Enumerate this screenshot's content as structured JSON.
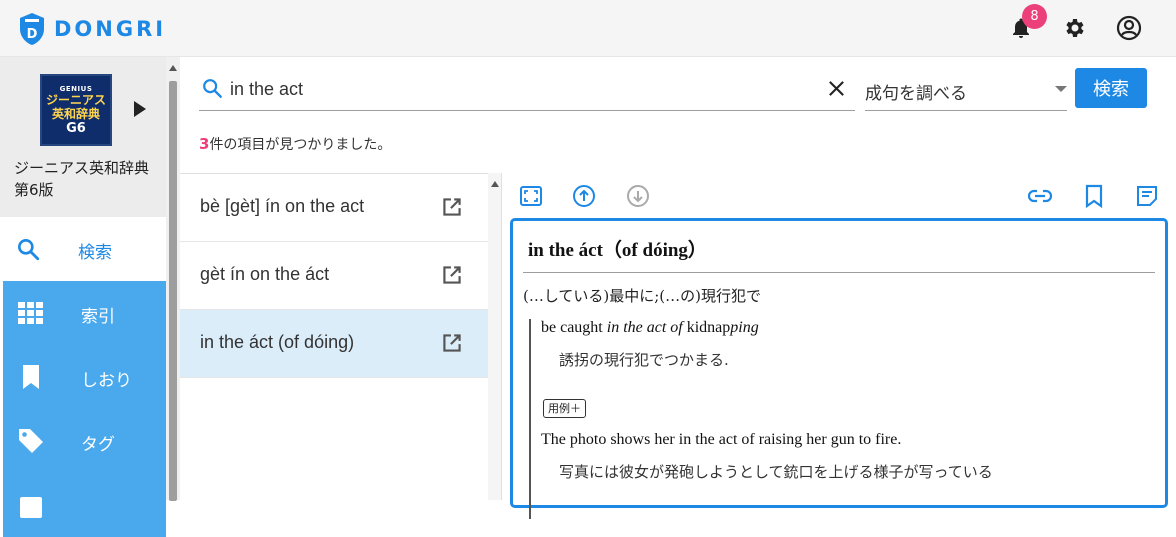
{
  "app": {
    "logo_text": "DONGRI",
    "notification_count": "8"
  },
  "dictionary": {
    "cover": {
      "genius": "GENIUS",
      "title": "ジーニアス英和辞典",
      "edition": "G6"
    },
    "name": "ジーニアス英和辞典第6版"
  },
  "nav": {
    "items": [
      {
        "label": "検索",
        "icon": "search-icon"
      },
      {
        "label": "索引",
        "icon": "grid-icon"
      },
      {
        "label": "しおり",
        "icon": "bookmark-icon"
      },
      {
        "label": "タグ",
        "icon": "tag-icon"
      }
    ]
  },
  "search": {
    "query": "in the act",
    "mode": "成句を調べる",
    "button_label": "検索",
    "result_count": "3",
    "result_suffix": "件の項目が見つかりました。"
  },
  "results": [
    {
      "label": "bè [gèt] ín on the act"
    },
    {
      "label": "gèt ín on the áct"
    },
    {
      "label": "in the áct (of dóing)",
      "selected": true
    }
  ],
  "entry": {
    "headword": "in the áct（of dóing）",
    "definition": "(…している)最中に;(…の)現行犯で",
    "example1": {
      "en_prefix": "be caught ",
      "en_italic": "in the act of",
      "en_mid": " kidnap",
      "en_italic2": "ping",
      "ja": "誘拐の現行犯でつかまる."
    },
    "example_tag": "用例＋",
    "example2": {
      "en": "The photo shows her in the act of raising her gun to fire.",
      "ja": "写真には彼女が発砲しようとして銃口を上げる様子が写っている"
    }
  },
  "colors": {
    "accent": "#1e88e5",
    "badge": "#ec407a",
    "nav_blue": "#4aa8ec",
    "selected_row": "#dcedfa"
  }
}
